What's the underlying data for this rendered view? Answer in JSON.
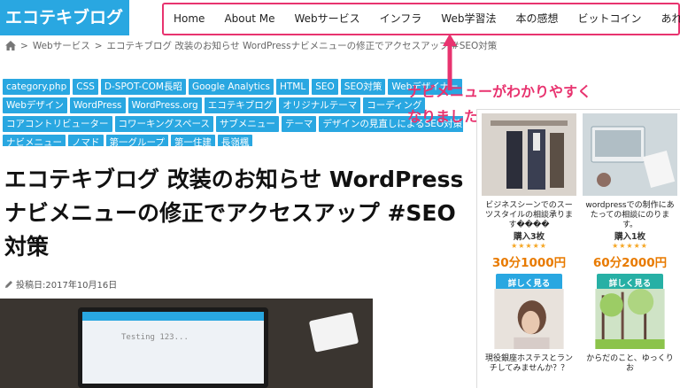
{
  "header": {
    "logo_text": "エコテキブログ",
    "nav": [
      "Home",
      "About Me",
      "Webサービス",
      "インフラ",
      "Web学習法",
      "本の感想",
      "ビットコイン",
      "あれこれ"
    ]
  },
  "breadcrumb": {
    "items": [
      "Webサービス",
      "エコテキブログ 改装のお知らせ WordPressナビメニューの修正でアクセスアップ #SEO対策"
    ],
    "separator": ">"
  },
  "tags": [
    [
      "category.php",
      "CSS",
      "D-SPOT-COM長昭",
      "Google Analytics",
      "HTML",
      "SEO",
      "SEO対策",
      "Webデザイナー"
    ],
    [
      "Webデザイン",
      "WordPress",
      "WordPress.org",
      "エコテキブログ",
      "オリジナルテーマ",
      "コーディング"
    ],
    [
      "コアコントリビューター",
      "コワーキングスペース",
      "サブメニュー",
      "テーマ",
      "デザインの見直しによるSEO対策"
    ],
    [
      "ナビメニュー",
      "ノマド",
      "第一グループ",
      "第一住建",
      "長嶺楓"
    ]
  ],
  "callout": {
    "line1": "ナビメニューがわかりやすく",
    "line2": "なりました！",
    "color": "#e8336f"
  },
  "article": {
    "title": "エコテキブログ 改装のお知らせ WordPressナビメニューの修正でアクセスアップ #SEO対策",
    "date_label": "投稿日:2017年10月16日"
  },
  "hero_image": {
    "screen_text": "Testing 123..."
  },
  "ads": [
    {
      "caption": "ビジネスシーンでのスーツスタイルの相談承ります����",
      "count": "購入3枚",
      "stars": "★★★★★",
      "price": "30分1000円",
      "button": "詳しく見る"
    },
    {
      "caption": "wordpressでの制作にあたっての相談にのります。",
      "count": "購入1枚",
      "stars": "★★★★★",
      "price": "60分2000円",
      "button": "詳しく見る"
    },
    {
      "caption": "現役銀座ホステスとランチしてみませんか？？",
      "count": "",
      "stars": "",
      "price": "",
      "button": ""
    },
    {
      "caption": "からだのこと、ゆっくりお",
      "count": "",
      "stars": "",
      "price": "",
      "button": ""
    }
  ],
  "colors": {
    "brand": "#29a7e1",
    "highlight": "#e8336f",
    "price": "#e87a00",
    "stars": "#f5a623"
  },
  "icons": [
    "home-icon",
    "pencil-icon",
    "arrow-up-icon"
  ]
}
